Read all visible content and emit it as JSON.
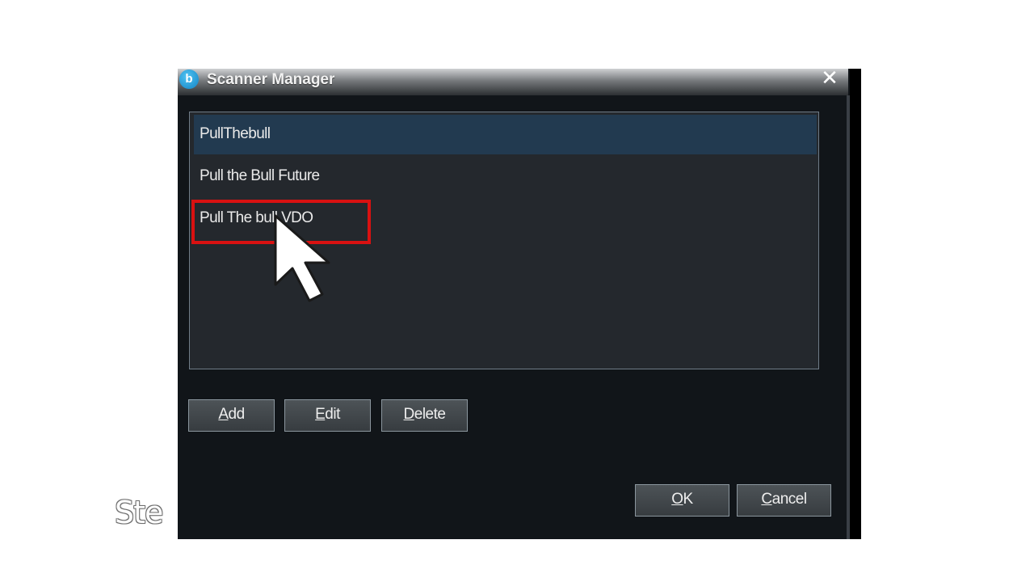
{
  "caption": {
    "text": "Ste"
  },
  "window": {
    "title": "Scanner Manager",
    "icon_letter": "b",
    "close_glyph": "✕",
    "icon": "app-logo-icon"
  },
  "list": {
    "items": [
      {
        "label": "PullThebull",
        "selected": true
      },
      {
        "label": "Pull the Bull Future",
        "selected": false
      },
      {
        "label": "Pull The bull VDO",
        "selected": false,
        "highlighted": true
      }
    ]
  },
  "buttons": {
    "add": {
      "mnemonic": "A",
      "rest": "dd"
    },
    "edit": {
      "mnemonic": "E",
      "rest": "dit"
    },
    "delete": {
      "mnemonic": "D",
      "rest": "elete"
    },
    "ok": {
      "mnemonic": "O",
      "rest": "K"
    },
    "cancel": {
      "mnemonic": "C",
      "rest": "ancel"
    }
  },
  "colors": {
    "dialog_bg": "#111519",
    "list_bg": "#24282d",
    "selected_bg": "#223a50",
    "highlight": "#d91111"
  }
}
